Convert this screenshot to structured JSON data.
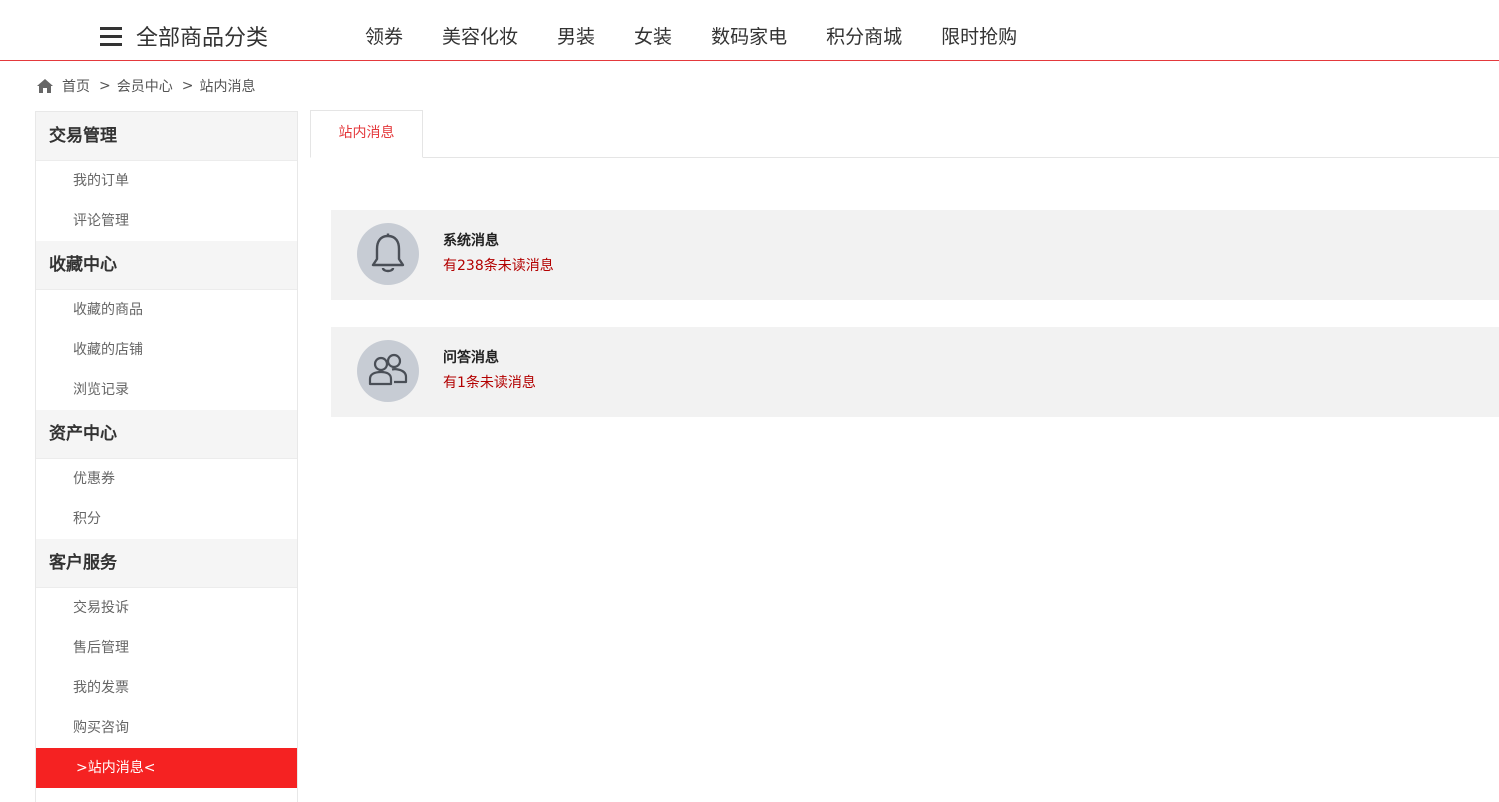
{
  "nav": {
    "all_categories": "全部商品分类",
    "items": [
      {
        "label": "领券"
      },
      {
        "label": "美容化妆"
      },
      {
        "label": "男装"
      },
      {
        "label": "女装"
      },
      {
        "label": "数码家电"
      },
      {
        "label": "积分商城"
      },
      {
        "label": "限时抢购"
      }
    ],
    "accent_color": "#e4393c"
  },
  "breadcrumb": {
    "home_icon": "home-icon",
    "items": [
      "首页",
      "会员中心",
      "站内消息"
    ],
    "separator": ">"
  },
  "sidebar": {
    "active_color": "#f52222",
    "groups": [
      {
        "title": "交易管理",
        "links": [
          "我的订单",
          "评论管理"
        ]
      },
      {
        "title": "收藏中心",
        "links": [
          "收藏的商品",
          "收藏的店铺",
          "浏览记录"
        ]
      },
      {
        "title": "资产中心",
        "links": [
          "优惠券",
          "积分"
        ]
      },
      {
        "title": "客户服务",
        "links": [
          "交易投诉",
          "售后管理",
          "我的发票",
          "购买咨询",
          ">站内消息<"
        ]
      }
    ]
  },
  "main": {
    "tab_label": "站内消息",
    "messages": [
      {
        "icon": "bell-icon",
        "title": "系统消息",
        "subtitle": "有238条未读消息"
      },
      {
        "icon": "users-icon",
        "title": "问答消息",
        "subtitle": "有1条未读消息"
      }
    ]
  }
}
